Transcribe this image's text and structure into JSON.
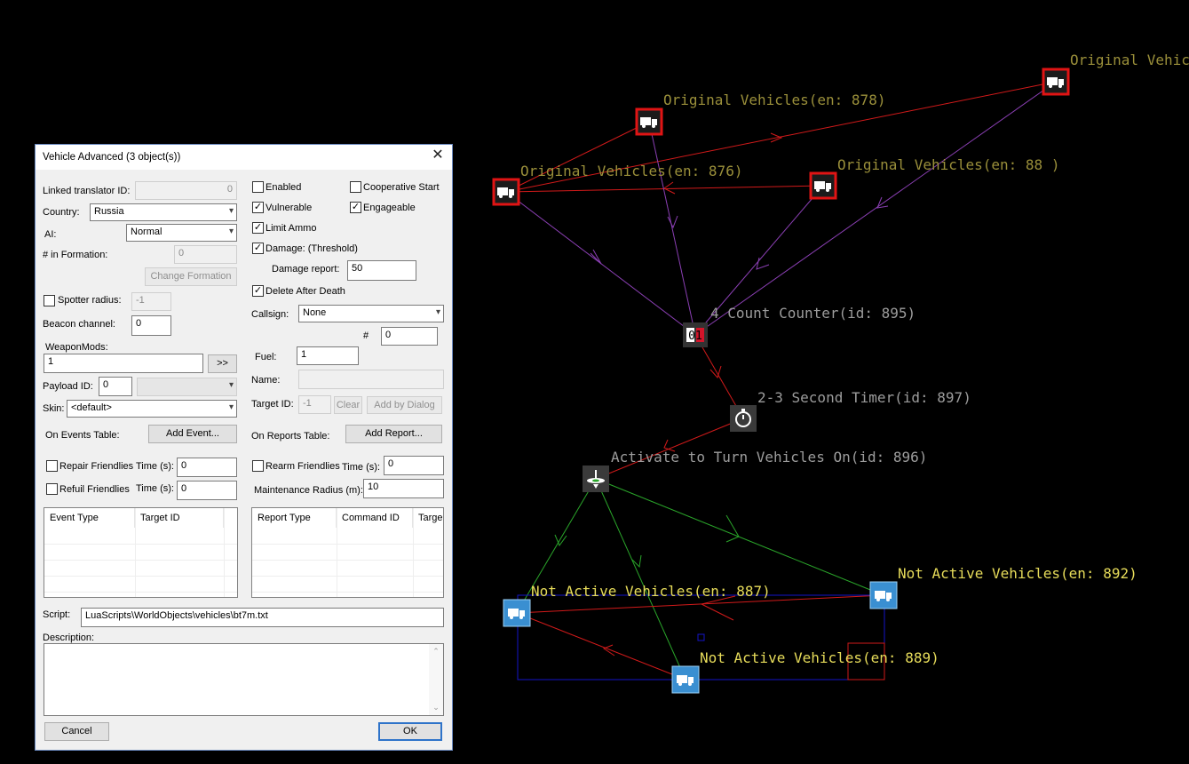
{
  "canvas": {
    "nodes": [
      {
        "id": "veh-878",
        "label": "Original Vehicles(en: 878)",
        "kind": "vehicle-original"
      },
      {
        "id": "veh-top-right",
        "label": "Original Vehic",
        "kind": "vehicle-original"
      },
      {
        "id": "veh-876",
        "label": "Original Vehicles(en: 876)",
        "kind": "vehicle-original"
      },
      {
        "id": "veh-881",
        "label": "Original Vehicles(en: 88 )",
        "kind": "vehicle-original"
      },
      {
        "id": "counter-895",
        "label": "4 Count Counter(id: 895)",
        "kind": "counter",
        "icon_text": "01"
      },
      {
        "id": "timer-897",
        "label": "2-3 Second Timer(id: 897)",
        "kind": "timer"
      },
      {
        "id": "activate-896",
        "label": "Activate to Turn Vehicles On(id: 896)",
        "kind": "activator"
      },
      {
        "id": "veh-887",
        "label": "Not Active Vehicles(en: 887)",
        "kind": "vehicle-inactive"
      },
      {
        "id": "veh-892",
        "label": "Not Active Vehicles(en: 892)",
        "kind": "vehicle-inactive"
      },
      {
        "id": "veh-889",
        "label": "Not Active Vehicles(en: 889)",
        "kind": "vehicle-inactive"
      }
    ],
    "colors": {
      "red": "#d11a1a",
      "purple": "#8a3fb3",
      "green": "#2aa52a",
      "blue": "#1414c8",
      "label_dim": "#9a8f3a",
      "label_bright": "#e7dc5a"
    }
  },
  "dialog": {
    "title": "Vehicle Advanced (3 object(s))",
    "linked_translator_label": "Linked translator ID:",
    "linked_translator_value": "0",
    "country_label": "Country:",
    "country_value": "Russia",
    "ai_label": "AI:",
    "ai_value": "Normal",
    "formation_label": "# in Formation:",
    "formation_value": "0",
    "change_formation": "Change Formation",
    "spotter_label": "Spotter radius:",
    "spotter_value": "-1",
    "beacon_label": "Beacon channel:",
    "beacon_value": "0",
    "weaponmods_label": "WeaponMods:",
    "weaponmods_value": "1",
    "weaponmods_btn": ">>",
    "payload_label": "Payload ID:",
    "payload_value": "0",
    "skin_label": "Skin:",
    "skin_value": "<default>",
    "events_table_label": "On Events Table:",
    "add_event": "Add Event...",
    "repair_label": "Repair Friendlies",
    "refuil_label": "Refuil Friendlies",
    "time_label": "Time (s):",
    "repair_time": "0",
    "refuil_time": "0",
    "events_cols": [
      "Event Type",
      "Target ID"
    ],
    "enabled_label": "Enabled",
    "coop_label": "Cooperative Start",
    "vulnerable_label": "Vulnerable",
    "engageable_label": "Engageable",
    "limit_ammo_label": "Limit Ammo",
    "damage_label": "Damage: (Threshold)",
    "damage_report_label": "Damage report:",
    "damage_report_value": "50",
    "delete_label": "Delete After Death",
    "callsign_label": "Callsign:",
    "callsign_value": "None",
    "hash_label": "#",
    "hash_value": "0",
    "fuel_label": "Fuel:",
    "fuel_value": "1",
    "name_label": "Name:",
    "target_label": "Target ID:",
    "target_value": "-1",
    "clear_btn": "Clear",
    "add_by_dialog": "Add by Dialog",
    "reports_table_label": "On Reports Table:",
    "add_report": "Add Report...",
    "rearm_label": "Rearm Friendlies",
    "rearm_time_label": "Time (s):",
    "rearm_time": "0",
    "maint_label": "Maintenance Radius (m):",
    "maint_value": "10",
    "reports_cols": [
      "Report Type",
      "Command ID",
      "Targe"
    ],
    "script_label": "Script:",
    "script_value": "LuaScripts\\WorldObjects\\vehicles\\bt7m.txt",
    "description_label": "Description:",
    "cancel": "Cancel",
    "ok": "OK",
    "checks": {
      "spotter": false,
      "repair": false,
      "refuil": false,
      "enabled": false,
      "coop": false,
      "vulnerable": true,
      "engageable": true,
      "limit_ammo": true,
      "damage": true,
      "delete": true,
      "rearm": false
    }
  }
}
